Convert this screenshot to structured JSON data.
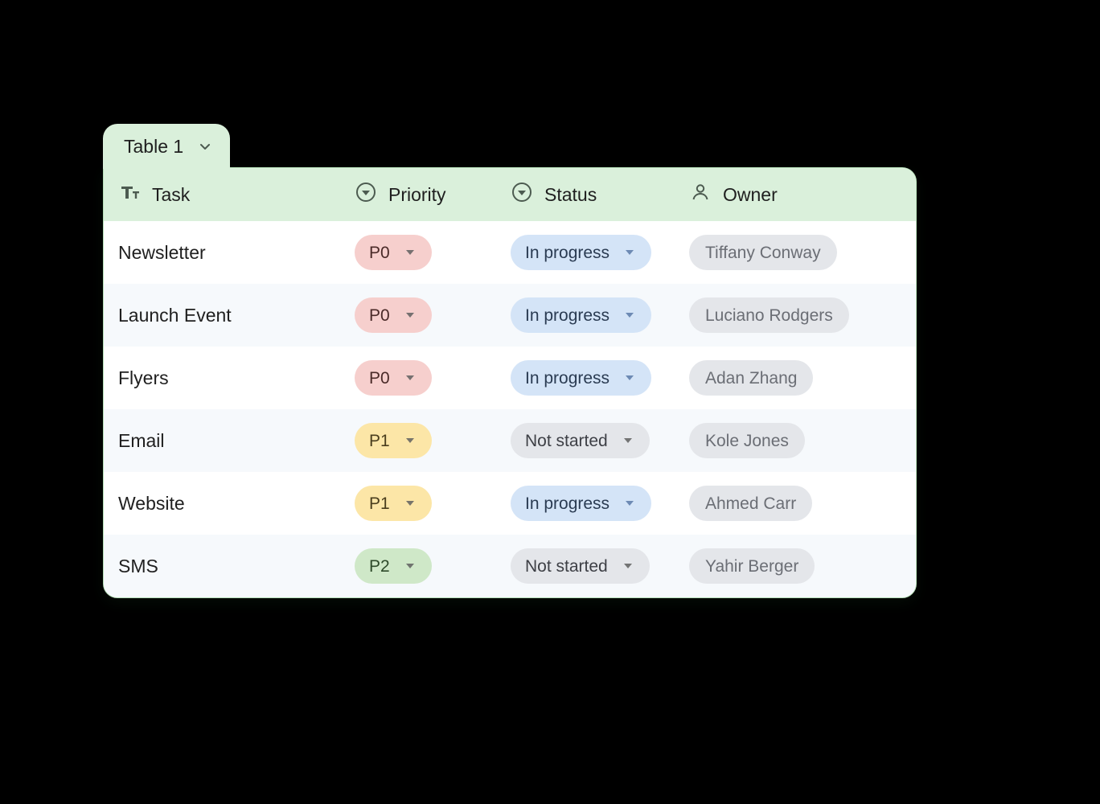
{
  "tab": {
    "label": "Table 1"
  },
  "columns": {
    "task": {
      "label": "Task"
    },
    "priority": {
      "label": "Priority"
    },
    "status": {
      "label": "Status"
    },
    "owner": {
      "label": "Owner"
    }
  },
  "priority_colors": {
    "P0": "p0",
    "P1": "p1",
    "P2": "p2"
  },
  "status_colors": {
    "In progress": "inprog",
    "Not started": "notstart"
  },
  "rows": [
    {
      "task": "Newsletter",
      "priority": "P0",
      "status": "In progress",
      "owner": "Tiffany Conway"
    },
    {
      "task": "Launch Event",
      "priority": "P0",
      "status": "In progress",
      "owner": "Luciano Rodgers"
    },
    {
      "task": "Flyers",
      "priority": "P0",
      "status": "In progress",
      "owner": "Adan Zhang"
    },
    {
      "task": "Email",
      "priority": "P1",
      "status": "Not started",
      "owner": "Kole Jones"
    },
    {
      "task": "Website",
      "priority": "P1",
      "status": "In progress",
      "owner": "Ahmed Carr"
    },
    {
      "task": "SMS",
      "priority": "P2",
      "status": "Not started",
      "owner": "Yahir Berger"
    }
  ],
  "colors": {
    "header_bg": "#daf0db",
    "row_alt_bg": "#f6f9fc",
    "p0": "#f6cfcd",
    "p1": "#fce6a7",
    "p2": "#cfe8c8",
    "in_progress": "#d4e4f7",
    "not_started": "#e4e6ea",
    "owner_pill": "#e4e6ea"
  }
}
